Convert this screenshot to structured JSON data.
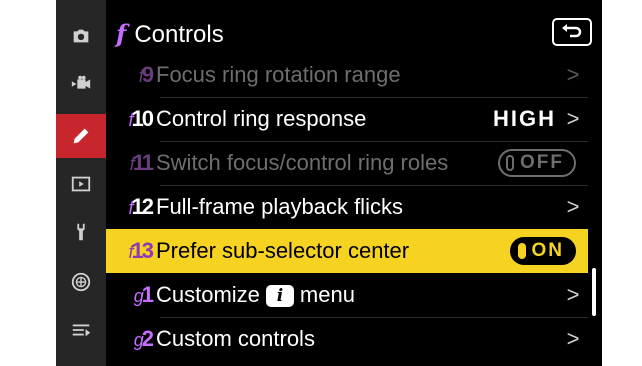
{
  "header": {
    "menu_letter": "f",
    "title": "Controls"
  },
  "tabs": [
    {
      "name": "photo-shooting-menu-icon",
      "active": false
    },
    {
      "name": "video-recording-menu-icon",
      "active": false
    },
    {
      "name": "custom-settings-menu-icon",
      "active": true
    },
    {
      "name": "playback-menu-icon",
      "active": false
    },
    {
      "name": "setup-menu-icon",
      "active": false
    },
    {
      "name": "network-menu-icon",
      "active": false
    },
    {
      "name": "my-menu-icon",
      "active": false
    }
  ],
  "items": [
    {
      "prefix": "f",
      "num": "9",
      "label": "Focus ring rotation range",
      "value": "",
      "dim": true
    },
    {
      "prefix": "f",
      "num": "10",
      "label": "Control ring response",
      "value": "HIGH"
    },
    {
      "prefix": "f",
      "num": "11",
      "label": "Switch focus/control ring roles",
      "toggle": "OFF",
      "dim": true
    },
    {
      "prefix": "f",
      "num": "12",
      "label": "Full-frame playback flicks",
      "value": ""
    },
    {
      "prefix": "f",
      "num": "13",
      "label": "Prefer sub-selector center",
      "toggle": "ON",
      "selected": true
    },
    {
      "prefix": "g",
      "num": "1",
      "label_before": "Customize",
      "label_after": "menu"
    },
    {
      "prefix": "g",
      "num": "2",
      "label": "Custom controls",
      "value": ""
    }
  ],
  "colors": {
    "selected": "#f6d320",
    "active_tab": "#c8262d",
    "accent": "#c66cff"
  }
}
